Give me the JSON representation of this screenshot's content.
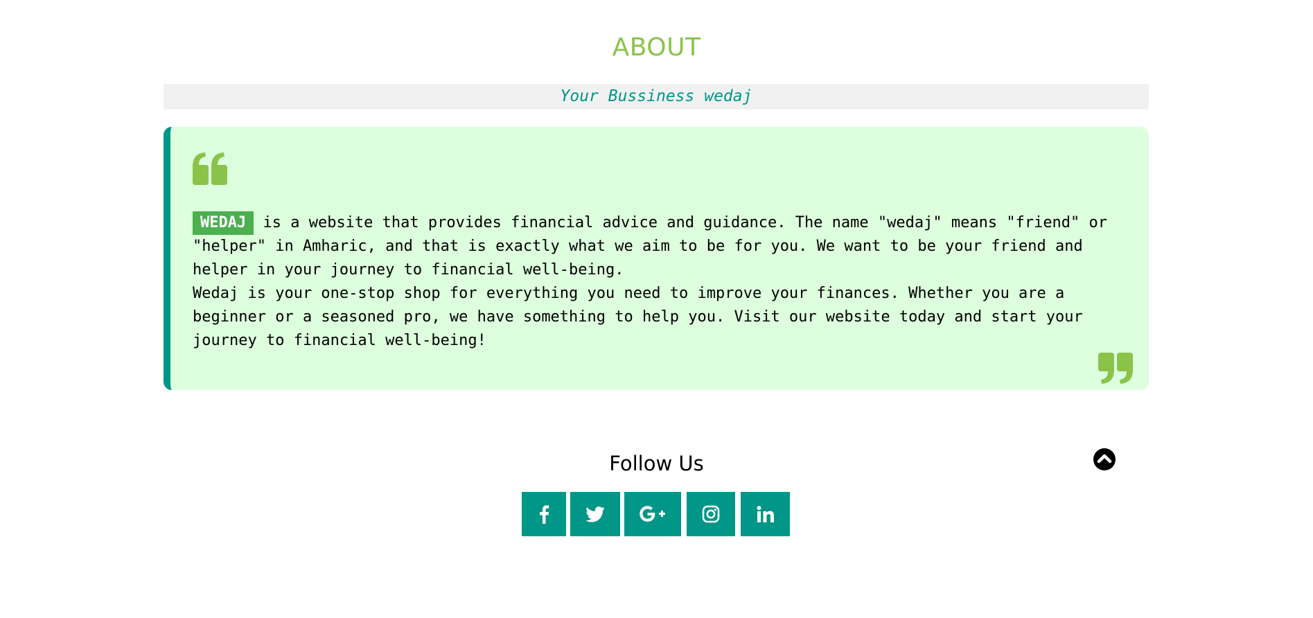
{
  "about": {
    "title": "ABOUT",
    "subtitle": "Your Bussiness wedaj"
  },
  "quote": {
    "brand": "WEDAJ",
    "paragraph1_rest": " is a website that provides financial advice and guidance. The name \"wedaj\" means \"friend\" or \"helper\" in Amharic, and that is exactly what we aim to be for you. We want to be your friend and helper in your journey to financial well-being.",
    "paragraph2": "Wedaj is your one-stop shop for everything you need to improve your finances. Whether you are a beginner or a seasoned pro, we have something to help you. Visit our website today and start your journey to financial well-being!"
  },
  "follow": {
    "title": "Follow Us",
    "networks": [
      "facebook-icon",
      "twitter-icon",
      "google-plus-icon",
      "instagram-icon",
      "linkedin-icon"
    ]
  },
  "icons": {
    "quote_open": "quote-open-icon",
    "quote_close": "quote-close-icon",
    "back_to_top": "chevron-up-icon"
  },
  "colors": {
    "accent_green": "#8bc34a",
    "teal": "#009688",
    "card_bg": "#ddffdd",
    "brand_tag_bg": "#4caf50",
    "subtitle_bar_bg": "#f1f1f1"
  }
}
